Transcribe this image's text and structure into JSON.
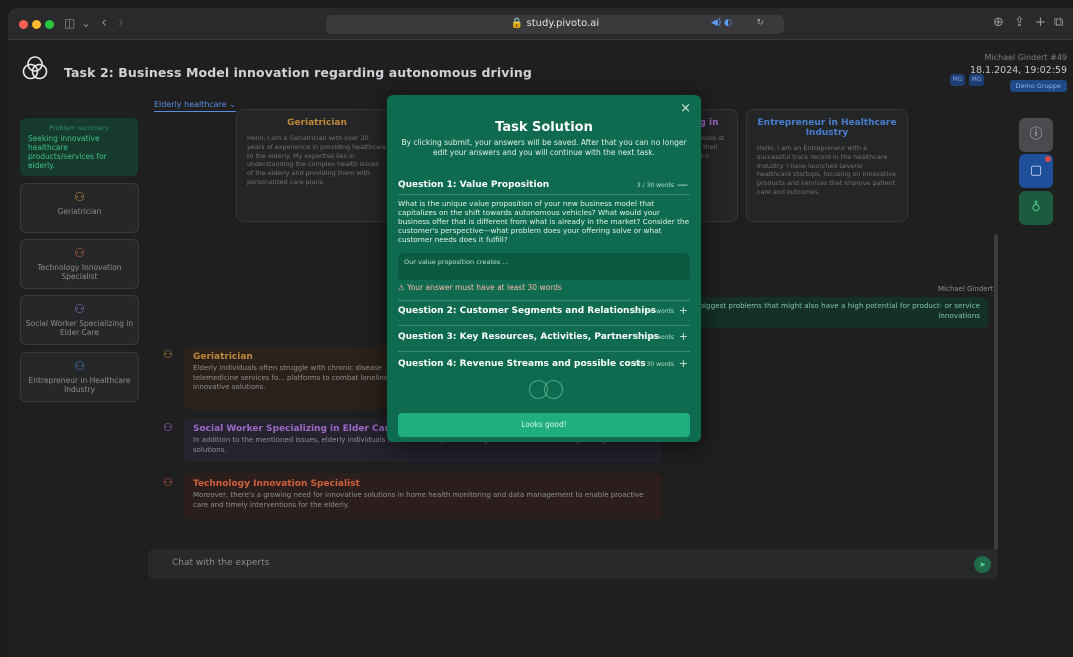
{
  "browser": {
    "url": "study.pivoto.ai",
    "nav_sidebar_icon": "◫",
    "nav_chevron": "⌄",
    "nav_back": "‹",
    "nav_forward": "›",
    "sound_icon": "◀) ◐",
    "refresh_icon": "↻",
    "right_icons": [
      "⊕",
      "⇪",
      "+",
      "⧉"
    ]
  },
  "header": {
    "title": "Task 2: Business Model innovation regarding autonomous driving",
    "user_name": "Michael Gindert #49",
    "date": "18.1.2024, 19:02:59",
    "group_badge": "Demo Gruppe",
    "mg_badges": [
      "MG",
      "MG"
    ]
  },
  "sidebar": {
    "summary_heading": "Problem summary",
    "summary_text": "Seeking innovative healthcare products/services for elderly.",
    "items": [
      {
        "label": "Geriatrician",
        "color": "#c08a3a"
      },
      {
        "label": "Technology Innovation Specialist",
        "color": "#c0603a"
      },
      {
        "label": "Social Worker Specializing in Elder Care",
        "color": "#9b6ac8"
      },
      {
        "label": "Entrepreneur in Healthcare Industry",
        "color": "#4a7fd0"
      }
    ]
  },
  "tab": {
    "label": "Elderly healthcare",
    "chevron": "⌄"
  },
  "expert_cards": [
    {
      "name": "Geriatrician",
      "color": "#c08a3a",
      "desc": "Hello, I am a Geriatrician with over 20 years of experience in providing healthcare to the elderly. My expertise lies in understanding the complex health issues of the elderly and providing them with personalized care plans."
    },
    {
      "name": "ng in",
      "color": "#9b6ac8",
      "desc": "cializes st 15 their the v"
    },
    {
      "name": "Entrepreneur in Healthcare Industry",
      "color": "#4a7fd0",
      "desc": "Hello, I am an Entrepreneur with a successful track record in the healthcare industry. I have launched several healthcare startups, focusing on innovative products and services that improve patient care and outcomes."
    }
  ],
  "chat": {
    "user_label": "Michael Gindert",
    "user_message": "how the biggest problems that might also have a high potential for product- or service innovations",
    "messages": [
      {
        "name": "Geriatrician",
        "color": "#c08a3a",
        "bg": "#2a211a",
        "text": "Elderly individuals often struggle with chronic disease ... opportunity for innovation in telemedicine services fo... platforms to combat loneliness and improve mental he... benefit from innovative solutions."
      },
      {
        "name": "Social Worker Specializing in Elder Care",
        "color": "#9b6ac8",
        "bg": "#26222e",
        "text": "In addition to the mentioned issues, elderly individuals ... could be simplified through innovative service design or digital solutions."
      },
      {
        "name": "Technology Innovation Specialist",
        "color": "#d0603a",
        "bg": "#2b1e1c",
        "text": "Moreover, there's a growing need for innovative solutions in home health monitoring and data management to enable proactive care and timely interventions for the elderly."
      }
    ],
    "input_placeholder": "Chat with the experts",
    "send_icon": "➤"
  },
  "modal": {
    "title": "Task Solution",
    "close_icon": "×",
    "subtitle": "By clicking submit, your answers will be saved. After that you can no longer edit your answers and you will continue with the next task.",
    "questions": [
      {
        "label": "Question 1: Value Proposition",
        "count": "3 / 30 words",
        "toggle": "—"
      },
      {
        "label": "Question 2: Customer Segments and Relationships",
        "count": "33 / 30 words",
        "toggle": "+"
      },
      {
        "label": "Question 3: Key Resources, Activities, Partnerships",
        "count": "33 / 30 words",
        "toggle": "+"
      },
      {
        "label": "Question 4: Revenue Streams and possible costs",
        "count": "33 / 30 words",
        "toggle": "+"
      }
    ],
    "q1_text": "What is the unique value proposition of your new business model that capitalizes on the shift towards autonomous vehicles? What would your business offer that is different from what is already in the market? Consider the customer's perspective—what problem does your offering solve or what customer needs does it fulfill?",
    "answer_value": "Our value proposition creates ...",
    "error_icon": "⚠",
    "error_text": "Your answer must have at least 30 words",
    "submit_label": "Looks good!"
  }
}
